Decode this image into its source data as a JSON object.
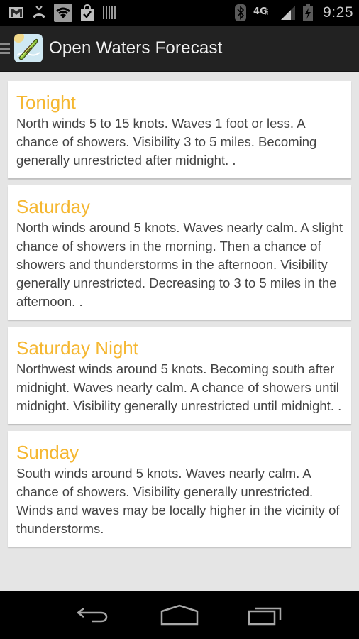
{
  "status_bar": {
    "left_icons": [
      "gmail-icon",
      "missed-call-icon",
      "wifi-icon",
      "shopping-bag-icon",
      "barcode-icon"
    ],
    "right_icons": [
      "bluetooth-icon",
      "4g-lte-icon",
      "signal-icon",
      "battery-charging-icon"
    ],
    "network_label": "4G",
    "network_sub": "LTE",
    "time": "9:25"
  },
  "app_bar": {
    "title": "Open Waters Forecast",
    "icon": "boat-app-icon",
    "menu_icon": "drawer-menu-icon"
  },
  "colors": {
    "title_accent": "#f5b731",
    "body_text": "#444444",
    "app_bar": "#222222",
    "background": "#e5e5e5"
  },
  "forecasts": [
    {
      "period": "Tonight",
      "text": "North winds 5 to 15 knots. Waves 1 foot or less. A chance of showers. Visibility 3 to 5 miles. Becoming generally unrestricted after midnight. ."
    },
    {
      "period": "Saturday",
      "text": "North winds around 5 knots. Waves nearly calm. A slight chance of showers in the morning. Then a chance of showers and thunderstorms in the afternoon. Visibility generally unrestricted. Decreasing to 3 to 5 miles in the afternoon. ."
    },
    {
      "period": "Saturday Night",
      "text": "Northwest winds around 5 knots. Becoming south after midnight. Waves nearly calm. A chance of showers until midnight. Visibility generally unrestricted until midnight. ."
    },
    {
      "period": "Sunday",
      "text": "South winds around 5 knots. Waves nearly calm. A chance of showers. Visibility generally unrestricted. Winds and waves may be locally higher in the vicinity of thunderstorms."
    }
  ],
  "nav_bar": {
    "buttons": [
      "back",
      "home",
      "recent-apps"
    ]
  }
}
